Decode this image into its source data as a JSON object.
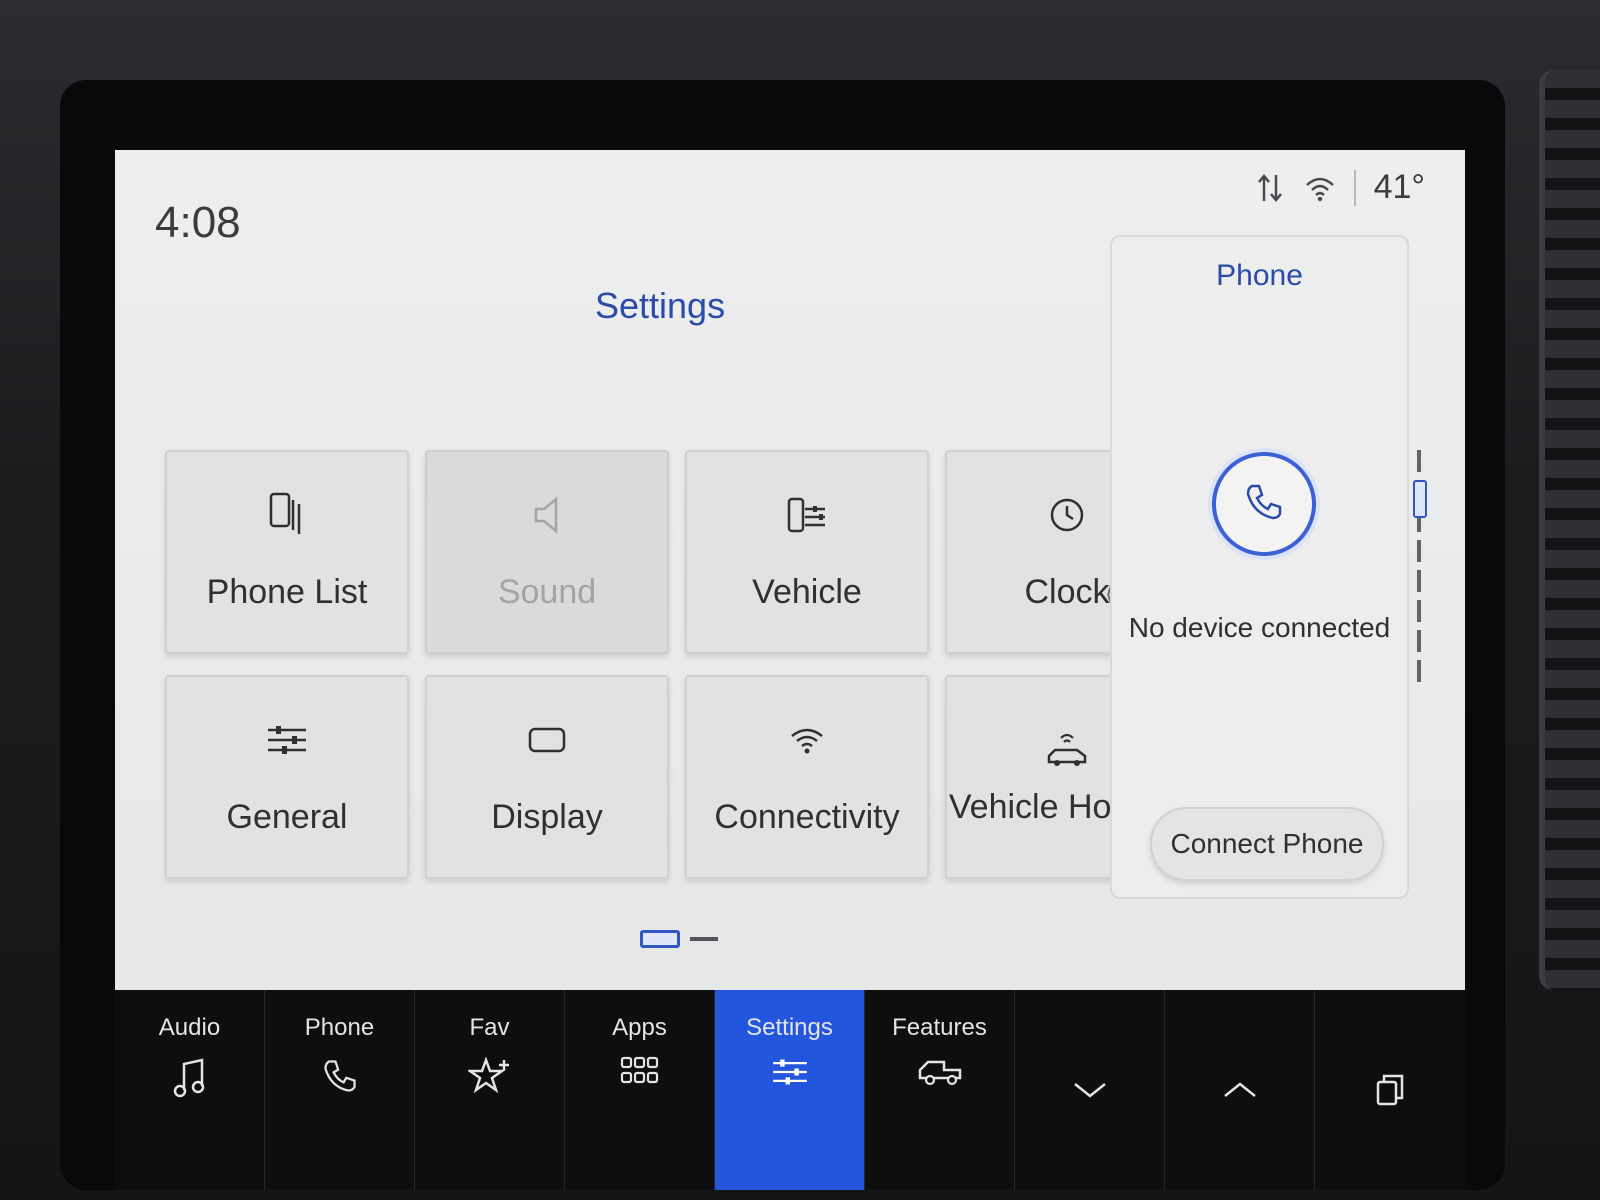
{
  "status_bar": {
    "time": "4:08",
    "temperature": "41°",
    "icons": [
      "signal-arrows-icon",
      "wifi-icon"
    ]
  },
  "settings": {
    "title": "Settings",
    "tiles": [
      {
        "label": "Phone List",
        "icon": "phone-list-icon",
        "enabled": true
      },
      {
        "label": "Sound",
        "icon": "speaker-icon",
        "enabled": false
      },
      {
        "label": "Vehicle",
        "icon": "vehicle-settings-icon",
        "enabled": true
      },
      {
        "label": "Clock",
        "icon": "clock-icon",
        "enabled": true
      },
      {
        "label": "General",
        "icon": "sliders-icon",
        "enabled": true
      },
      {
        "label": "Display",
        "icon": "display-icon",
        "enabled": true
      },
      {
        "label": "Connectivity",
        "icon": "wifi-icon",
        "enabled": true
      },
      {
        "label": "Vehicle Hotspot",
        "icon": "car-hotspot-icon",
        "enabled": true
      }
    ],
    "page_indicator": {
      "current": 1,
      "total": 2
    }
  },
  "phone_panel": {
    "title": "Phone",
    "status": "No device connected",
    "button_label": "Connect Phone"
  },
  "nav": {
    "items": [
      {
        "label": "Audio",
        "icon": "music-note-icon"
      },
      {
        "label": "Phone",
        "icon": "phone-icon"
      },
      {
        "label": "Fav",
        "icon": "star-plus-icon"
      },
      {
        "label": "Apps",
        "icon": "apps-grid-icon"
      },
      {
        "label": "Settings",
        "icon": "sliders-icon",
        "active": true
      },
      {
        "label": "Features",
        "icon": "truck-icon"
      }
    ],
    "controls": [
      "chevron-down-icon",
      "chevron-up-icon",
      "copy-screen-icon"
    ]
  },
  "colors": {
    "accent": "#2356dc",
    "title_blue": "#2b4ba8",
    "nav_bg": "#0d0e10",
    "screen_bg": "#e9eaea"
  }
}
